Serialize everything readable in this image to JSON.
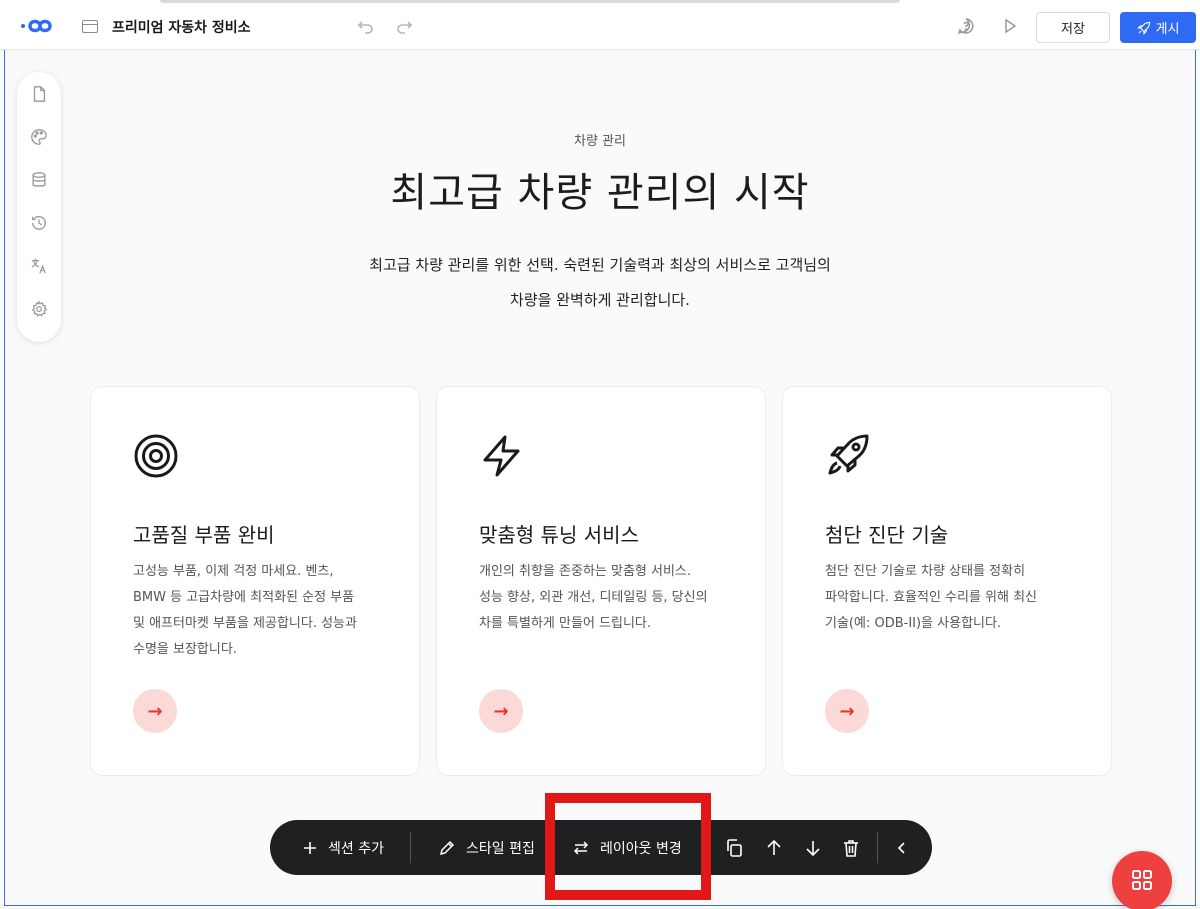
{
  "topbar": {
    "site_title": "프리미엄 자동차 정비소",
    "save_label": "저장",
    "publish_label": "게시"
  },
  "hero": {
    "eyebrow": "차량 관리",
    "headline": "최고급 차량 관리의 시작",
    "subtext_line1": "최고급 차량 관리를 위한 선택. 숙련된 기술력과 최상의 서비스로 고객님의",
    "subtext_line2": "차량을 완벽하게 관리합니다."
  },
  "cards": [
    {
      "icon": "target-icon",
      "title": "고품질 부품 완비",
      "desc_lines": [
        "고성능 부품, 이제 걱정 마세요. 벤츠,",
        "BMW 등 고급차량에 최적화된 순정 부품",
        "및 애프터마켓 부품을 제공합니다. 성능과",
        "수명을 보장합니다."
      ]
    },
    {
      "icon": "lightning-icon",
      "title": "맞춤형 튜닝 서비스",
      "desc_lines": [
        "개인의 취향을 존중하는 맞춤형 서비스.",
        "성능 향상, 외관 개선, 디테일링 등, 당신의",
        "차를 특별하게 만들어 드립니다."
      ]
    },
    {
      "icon": "rocket-icon",
      "title": "첨단 진단 기술",
      "desc_lines": [
        "첨단 진단 기술로 차량 상태를 정확히",
        "파악합니다. 효율적인 수리를 위해 최신",
        "기술(예: ODB-II)을 사용합니다."
      ]
    }
  ],
  "card_arrow_glyph": "→",
  "actionbar": {
    "add_section": "섹션 추가",
    "edit_style": "스타일 편집",
    "change_layout": "레이아웃 변경"
  },
  "colors": {
    "accent_blue": "#2f6bf2",
    "highlight_red": "#e01818",
    "fab_red": "#ef4040",
    "arrow_red": "#e23a2e"
  }
}
